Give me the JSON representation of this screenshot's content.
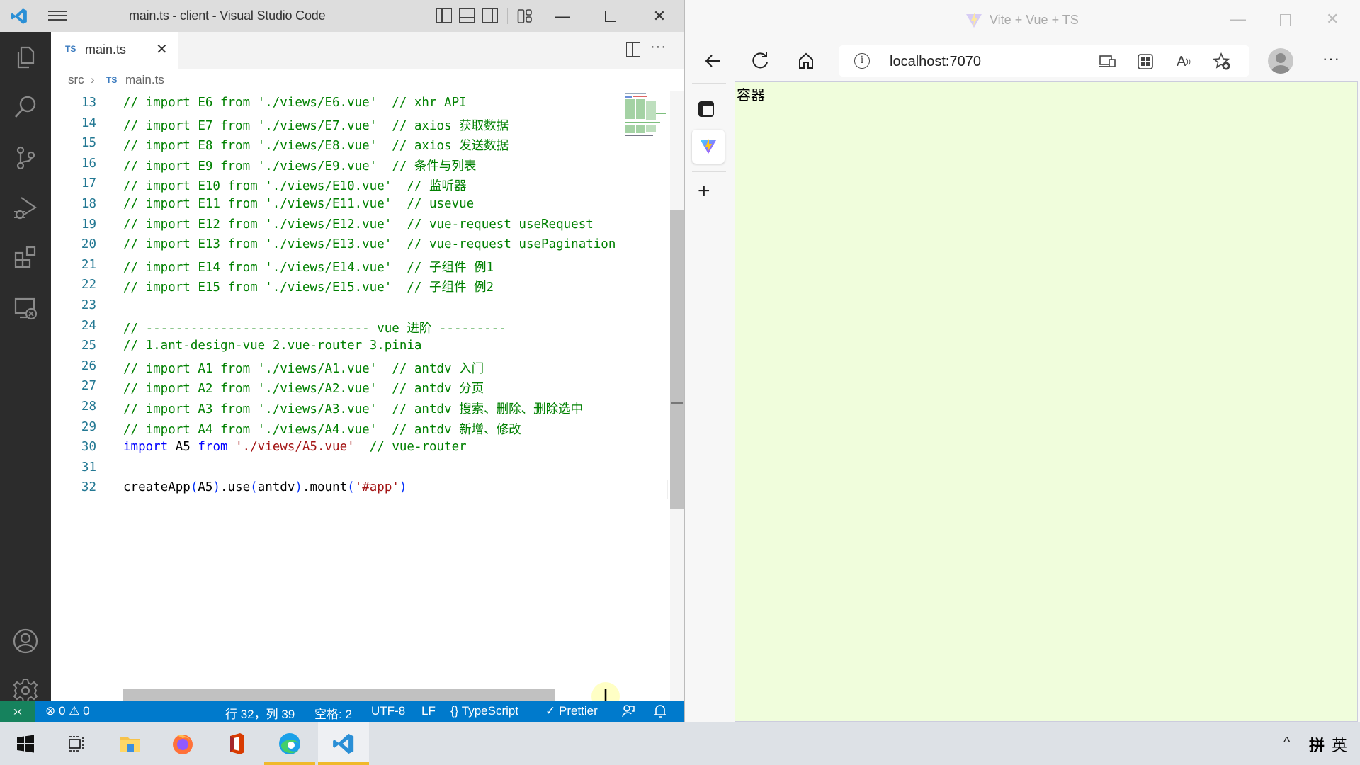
{
  "vscode": {
    "window_title": "main.ts - client - Visual Studio Code",
    "tab": {
      "lang_badge": "TS",
      "name": "main.ts",
      "close": "✕"
    },
    "breadcrumb": {
      "folder": "src",
      "sep": "›",
      "lang_badge": "TS",
      "file": "main.ts"
    },
    "activity_icons": [
      "explorer-icon",
      "search-icon",
      "source-control-icon",
      "run-debug-icon",
      "extensions-icon",
      "remote-explorer-icon",
      "accounts-icon",
      "settings-gear-icon"
    ],
    "code_lines": [
      {
        "n": "13",
        "parts": [
          [
            "cm",
            "// import E6 from './views/E6.vue'  // xhr API"
          ]
        ]
      },
      {
        "n": "14",
        "parts": [
          [
            "cm",
            "// import E7 from './views/E7.vue'  // axios 获取数据"
          ]
        ]
      },
      {
        "n": "15",
        "parts": [
          [
            "cm",
            "// import E8 from './views/E8.vue'  // axios 发送数据"
          ]
        ]
      },
      {
        "n": "16",
        "parts": [
          [
            "cm",
            "// import E9 from './views/E9.vue'  // 条件与列表"
          ]
        ]
      },
      {
        "n": "17",
        "parts": [
          [
            "cm",
            "// import E10 from './views/E10.vue'  // 监听器"
          ]
        ]
      },
      {
        "n": "18",
        "parts": [
          [
            "cm",
            "// import E11 from './views/E11.vue'  // usevue"
          ]
        ]
      },
      {
        "n": "19",
        "parts": [
          [
            "cm",
            "// import E12 from './views/E12.vue'  // vue-request useRequest"
          ]
        ]
      },
      {
        "n": "20",
        "parts": [
          [
            "cm",
            "// import E13 from './views/E13.vue'  // vue-request usePagination"
          ]
        ]
      },
      {
        "n": "21",
        "parts": [
          [
            "cm",
            "// import E14 from './views/E14.vue'  // 子组件 例1"
          ]
        ]
      },
      {
        "n": "22",
        "parts": [
          [
            "cm",
            "// import E15 from './views/E15.vue'  // 子组件 例2"
          ]
        ]
      },
      {
        "n": "23",
        "parts": []
      },
      {
        "n": "24",
        "parts": [
          [
            "cm",
            "// ------------------------------ vue 进阶 ---------"
          ]
        ]
      },
      {
        "n": "25",
        "parts": [
          [
            "cm",
            "// 1.ant-design-vue 2.vue-router 3.pinia"
          ]
        ]
      },
      {
        "n": "26",
        "parts": [
          [
            "cm",
            "// import A1 from './views/A1.vue'  // antdv 入门"
          ]
        ]
      },
      {
        "n": "27",
        "parts": [
          [
            "cm",
            "// import A2 from './views/A2.vue'  // antdv 分页"
          ]
        ]
      },
      {
        "n": "28",
        "parts": [
          [
            "cm",
            "// import A3 from './views/A3.vue'  // antdv 搜索、删除、删除选中"
          ]
        ]
      },
      {
        "n": "29",
        "parts": [
          [
            "cm",
            "// import A4 from './views/A4.vue'  // antdv 新增、修改"
          ]
        ]
      },
      {
        "n": "30",
        "parts": [
          [
            "kw",
            "import"
          ],
          [
            "pl",
            " A5 "
          ],
          [
            "kw",
            "from"
          ],
          [
            "pl",
            " "
          ],
          [
            "str",
            "'./views/A5.vue'"
          ],
          [
            "pl",
            "  "
          ],
          [
            "cm",
            "// vue-router"
          ]
        ]
      },
      {
        "n": "31",
        "parts": []
      },
      {
        "n": "32",
        "parts": [
          [
            "pl",
            "createApp"
          ],
          [
            "br",
            "("
          ],
          [
            "pl",
            "A5"
          ],
          [
            "br",
            ")"
          ],
          [
            "pl",
            ".use"
          ],
          [
            "br",
            "("
          ],
          [
            "pl",
            "antdv"
          ],
          [
            "br",
            ")"
          ],
          [
            "pl",
            ".mount"
          ],
          [
            "br",
            "("
          ],
          [
            "str",
            "'#app'"
          ],
          [
            "br",
            ")"
          ]
        ]
      }
    ],
    "status": {
      "errors": "0",
      "warnings": "0",
      "position": "行 32，列 39",
      "indent": "空格: 2",
      "encoding": "UTF-8",
      "eol": "LF",
      "language": "TypeScript",
      "formatter": "Prettier"
    },
    "colors": {
      "statusbar": "#007acc",
      "remote": "#16825d",
      "comment": "#008000",
      "keyword": "#0000ff",
      "string": "#a31515"
    }
  },
  "browser": {
    "window_title": "Vite + Vue + TS",
    "url": "localhost:7070",
    "page_text": "容器",
    "page_bg": "#f0fddc"
  },
  "taskbar": {
    "apps": [
      "start-menu",
      "task-view",
      "file-explorer",
      "firefox",
      "office",
      "edge",
      "vscode"
    ],
    "tray": {
      "ime_mode": "拼",
      "language": "英"
    }
  }
}
